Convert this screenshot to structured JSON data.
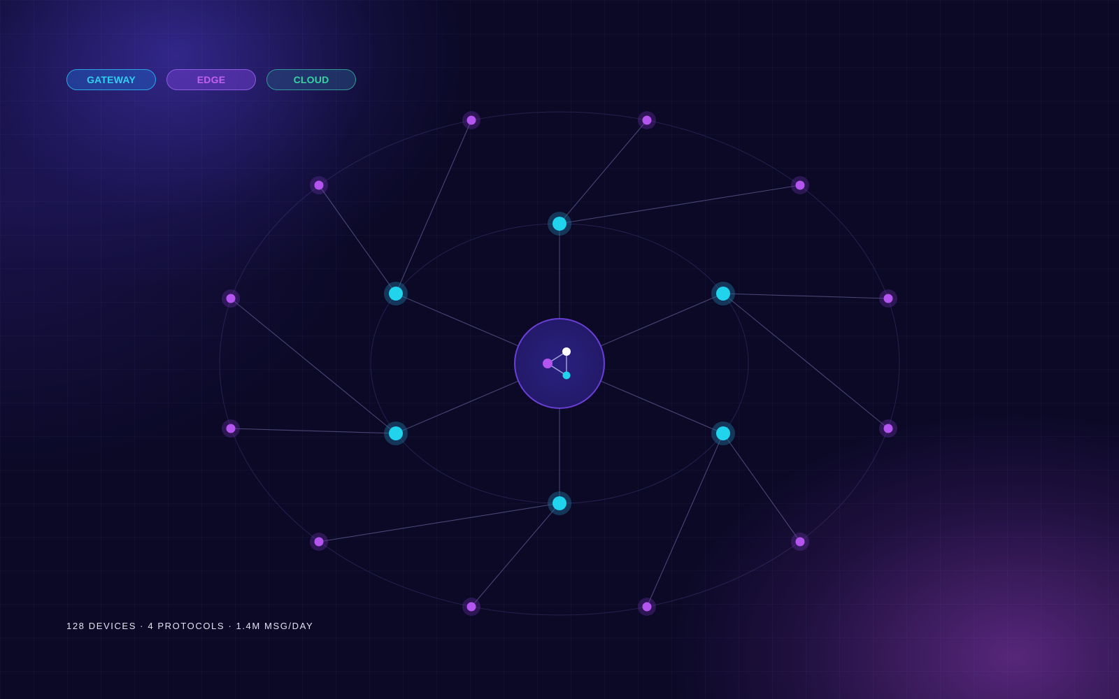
{
  "filters": {
    "gateway_label": "GATEWAY",
    "edge_label": "EDGE",
    "cloud_label": "CLOUD"
  },
  "footer": {
    "stats": "128 DEVICES · 4 PROTOCOLS · 1.4M MSG/DAY"
  },
  "colors": {
    "background": "#0b0926",
    "gateway_node": "#22d3ee",
    "edge_node": "#b455f0",
    "hub_fill": "#241b72",
    "hub_stroke": "#6b3fd6",
    "link": "#7e78b8",
    "orbit": "#3a3470"
  },
  "network": {
    "hub_label_nodes": [
      "white",
      "purple",
      "cyan"
    ],
    "gateway_count": 6,
    "edge_count": 12
  }
}
